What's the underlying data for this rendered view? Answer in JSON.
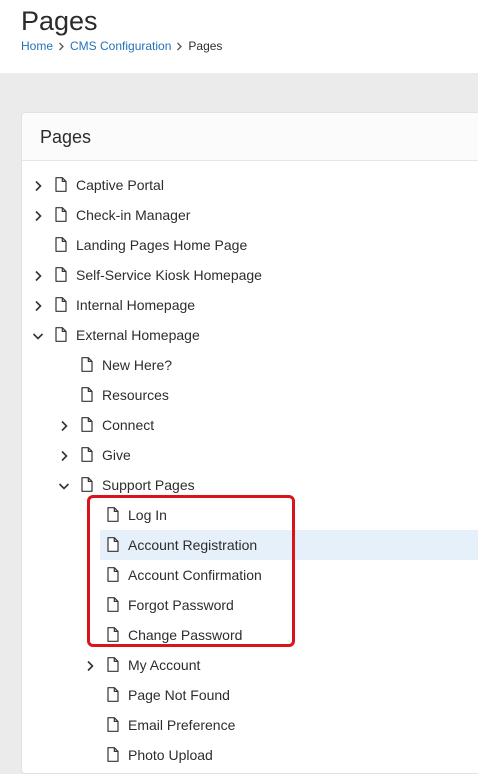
{
  "header": {
    "title": "Pages",
    "breadcrumb": [
      {
        "label": "Home",
        "link": true
      },
      {
        "label": "CMS Configuration",
        "link": true
      },
      {
        "label": "Pages",
        "link": false
      }
    ]
  },
  "panel": {
    "title": "Pages"
  },
  "tree": [
    {
      "label": "Captive Portal",
      "level": 0,
      "expander": "collapsed",
      "selected": false
    },
    {
      "label": "Check-in Manager",
      "level": 0,
      "expander": "collapsed",
      "selected": false
    },
    {
      "label": "Landing Pages Home Page",
      "level": 0,
      "expander": "none",
      "selected": false
    },
    {
      "label": "Self-Service Kiosk Homepage",
      "level": 0,
      "expander": "collapsed",
      "selected": false
    },
    {
      "label": "Internal Homepage",
      "level": 0,
      "expander": "collapsed",
      "selected": false
    },
    {
      "label": "External Homepage",
      "level": 0,
      "expander": "expanded",
      "selected": false
    },
    {
      "label": "New Here?",
      "level": 1,
      "expander": "none",
      "selected": false
    },
    {
      "label": "Resources",
      "level": 1,
      "expander": "none",
      "selected": false
    },
    {
      "label": "Connect",
      "level": 1,
      "expander": "collapsed",
      "selected": false
    },
    {
      "label": "Give",
      "level": 1,
      "expander": "collapsed",
      "selected": false
    },
    {
      "label": "Support Pages",
      "level": 1,
      "expander": "expanded",
      "selected": false
    },
    {
      "label": "Log In",
      "level": 2,
      "expander": "none",
      "selected": false
    },
    {
      "label": "Account Registration",
      "level": 2,
      "expander": "none",
      "selected": true
    },
    {
      "label": "Account Confirmation",
      "level": 2,
      "expander": "none",
      "selected": false
    },
    {
      "label": "Forgot Password",
      "level": 2,
      "expander": "none",
      "selected": false
    },
    {
      "label": "Change Password",
      "level": 2,
      "expander": "none",
      "selected": false
    },
    {
      "label": "My Account",
      "level": 2,
      "expander": "collapsed",
      "selected": false
    },
    {
      "label": "Page Not Found",
      "level": 2,
      "expander": "none",
      "selected": false
    },
    {
      "label": "Email Preference",
      "level": 2,
      "expander": "none",
      "selected": false
    },
    {
      "label": "Photo Upload",
      "level": 2,
      "expander": "none",
      "selected": false
    }
  ],
  "annotation": {
    "color": "#d9151b"
  },
  "colors": {
    "link": "#2373b9",
    "selected_row": "#e6f0fa"
  }
}
